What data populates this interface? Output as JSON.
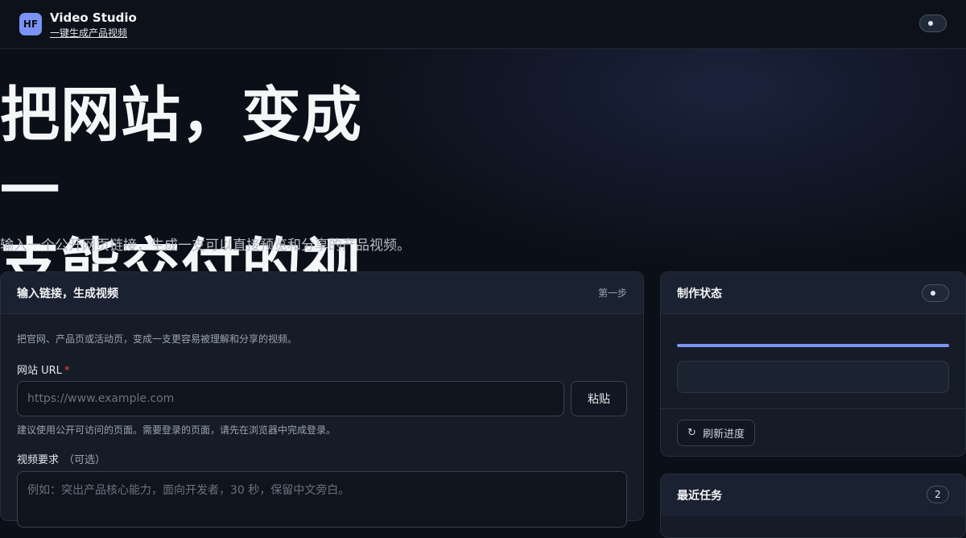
{
  "header": {
    "logo_text": "HF",
    "title": "Video Studio",
    "subtitle": "一键生成产品视频"
  },
  "hero": {
    "title_line1": "把网站，变成一",
    "title_line2": "支能交付的视频",
    "description": "输入一个公开网页链接，生成一支可以直接预览和分享的产品视频。"
  },
  "create_card": {
    "title": "输入链接，生成视频",
    "step": "第一步",
    "intro": "把官网、产品页或活动页，变成一支更容易被理解和分享的视频。",
    "url_label": "网站 URL",
    "url_required": "*",
    "url_placeholder": "https://www.example.com",
    "url_value": "",
    "paste_button": "粘贴",
    "url_hint": "建议使用公开可访问的页面。需要登录的页面，请先在浏览器中完成登录。",
    "req_label": "视频要求",
    "req_optional": "（可选）",
    "req_placeholder": "例如：突出产品核心能力，面向开发者，30 秒，保留中文旁白。"
  },
  "status_card": {
    "title": "制作状态",
    "refresh_icon": "↻",
    "refresh_label": "刷新进度",
    "progress_fraction": 1.0
  },
  "recent_card": {
    "title": "最近任务",
    "count": "2"
  },
  "colors": {
    "accent": "#7c93f2",
    "background": "#0b0f17",
    "card": "#161c27",
    "required": "#ef4444"
  }
}
